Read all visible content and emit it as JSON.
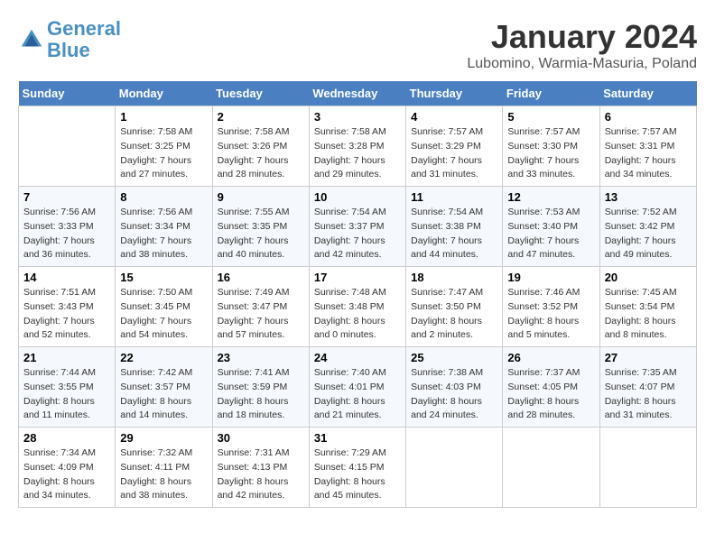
{
  "header": {
    "logo_line1": "General",
    "logo_line2": "Blue",
    "month_title": "January 2024",
    "location": "Lubomino, Warmia-Masuria, Poland"
  },
  "weekdays": [
    "Sunday",
    "Monday",
    "Tuesday",
    "Wednesday",
    "Thursday",
    "Friday",
    "Saturday"
  ],
  "weeks": [
    [
      {
        "day": "",
        "sunrise": "",
        "sunset": "",
        "daylight": ""
      },
      {
        "day": "1",
        "sunrise": "7:58 AM",
        "sunset": "3:25 PM",
        "daylight": "7 hours and 27 minutes."
      },
      {
        "day": "2",
        "sunrise": "7:58 AM",
        "sunset": "3:26 PM",
        "daylight": "7 hours and 28 minutes."
      },
      {
        "day": "3",
        "sunrise": "7:58 AM",
        "sunset": "3:28 PM",
        "daylight": "7 hours and 29 minutes."
      },
      {
        "day": "4",
        "sunrise": "7:57 AM",
        "sunset": "3:29 PM",
        "daylight": "7 hours and 31 minutes."
      },
      {
        "day": "5",
        "sunrise": "7:57 AM",
        "sunset": "3:30 PM",
        "daylight": "7 hours and 33 minutes."
      },
      {
        "day": "6",
        "sunrise": "7:57 AM",
        "sunset": "3:31 PM",
        "daylight": "7 hours and 34 minutes."
      }
    ],
    [
      {
        "day": "7",
        "sunrise": "7:56 AM",
        "sunset": "3:33 PM",
        "daylight": "7 hours and 36 minutes."
      },
      {
        "day": "8",
        "sunrise": "7:56 AM",
        "sunset": "3:34 PM",
        "daylight": "7 hours and 38 minutes."
      },
      {
        "day": "9",
        "sunrise": "7:55 AM",
        "sunset": "3:35 PM",
        "daylight": "7 hours and 40 minutes."
      },
      {
        "day": "10",
        "sunrise": "7:54 AM",
        "sunset": "3:37 PM",
        "daylight": "7 hours and 42 minutes."
      },
      {
        "day": "11",
        "sunrise": "7:54 AM",
        "sunset": "3:38 PM",
        "daylight": "7 hours and 44 minutes."
      },
      {
        "day": "12",
        "sunrise": "7:53 AM",
        "sunset": "3:40 PM",
        "daylight": "7 hours and 47 minutes."
      },
      {
        "day": "13",
        "sunrise": "7:52 AM",
        "sunset": "3:42 PM",
        "daylight": "7 hours and 49 minutes."
      }
    ],
    [
      {
        "day": "14",
        "sunrise": "7:51 AM",
        "sunset": "3:43 PM",
        "daylight": "7 hours and 52 minutes."
      },
      {
        "day": "15",
        "sunrise": "7:50 AM",
        "sunset": "3:45 PM",
        "daylight": "7 hours and 54 minutes."
      },
      {
        "day": "16",
        "sunrise": "7:49 AM",
        "sunset": "3:47 PM",
        "daylight": "7 hours and 57 minutes."
      },
      {
        "day": "17",
        "sunrise": "7:48 AM",
        "sunset": "3:48 PM",
        "daylight": "8 hours and 0 minutes."
      },
      {
        "day": "18",
        "sunrise": "7:47 AM",
        "sunset": "3:50 PM",
        "daylight": "8 hours and 2 minutes."
      },
      {
        "day": "19",
        "sunrise": "7:46 AM",
        "sunset": "3:52 PM",
        "daylight": "8 hours and 5 minutes."
      },
      {
        "day": "20",
        "sunrise": "7:45 AM",
        "sunset": "3:54 PM",
        "daylight": "8 hours and 8 minutes."
      }
    ],
    [
      {
        "day": "21",
        "sunrise": "7:44 AM",
        "sunset": "3:55 PM",
        "daylight": "8 hours and 11 minutes."
      },
      {
        "day": "22",
        "sunrise": "7:42 AM",
        "sunset": "3:57 PM",
        "daylight": "8 hours and 14 minutes."
      },
      {
        "day": "23",
        "sunrise": "7:41 AM",
        "sunset": "3:59 PM",
        "daylight": "8 hours and 18 minutes."
      },
      {
        "day": "24",
        "sunrise": "7:40 AM",
        "sunset": "4:01 PM",
        "daylight": "8 hours and 21 minutes."
      },
      {
        "day": "25",
        "sunrise": "7:38 AM",
        "sunset": "4:03 PM",
        "daylight": "8 hours and 24 minutes."
      },
      {
        "day": "26",
        "sunrise": "7:37 AM",
        "sunset": "4:05 PM",
        "daylight": "8 hours and 28 minutes."
      },
      {
        "day": "27",
        "sunrise": "7:35 AM",
        "sunset": "4:07 PM",
        "daylight": "8 hours and 31 minutes."
      }
    ],
    [
      {
        "day": "28",
        "sunrise": "7:34 AM",
        "sunset": "4:09 PM",
        "daylight": "8 hours and 34 minutes."
      },
      {
        "day": "29",
        "sunrise": "7:32 AM",
        "sunset": "4:11 PM",
        "daylight": "8 hours and 38 minutes."
      },
      {
        "day": "30",
        "sunrise": "7:31 AM",
        "sunset": "4:13 PM",
        "daylight": "8 hours and 42 minutes."
      },
      {
        "day": "31",
        "sunrise": "7:29 AM",
        "sunset": "4:15 PM",
        "daylight": "8 hours and 45 minutes."
      },
      {
        "day": "",
        "sunrise": "",
        "sunset": "",
        "daylight": ""
      },
      {
        "day": "",
        "sunrise": "",
        "sunset": "",
        "daylight": ""
      },
      {
        "day": "",
        "sunrise": "",
        "sunset": "",
        "daylight": ""
      }
    ]
  ]
}
